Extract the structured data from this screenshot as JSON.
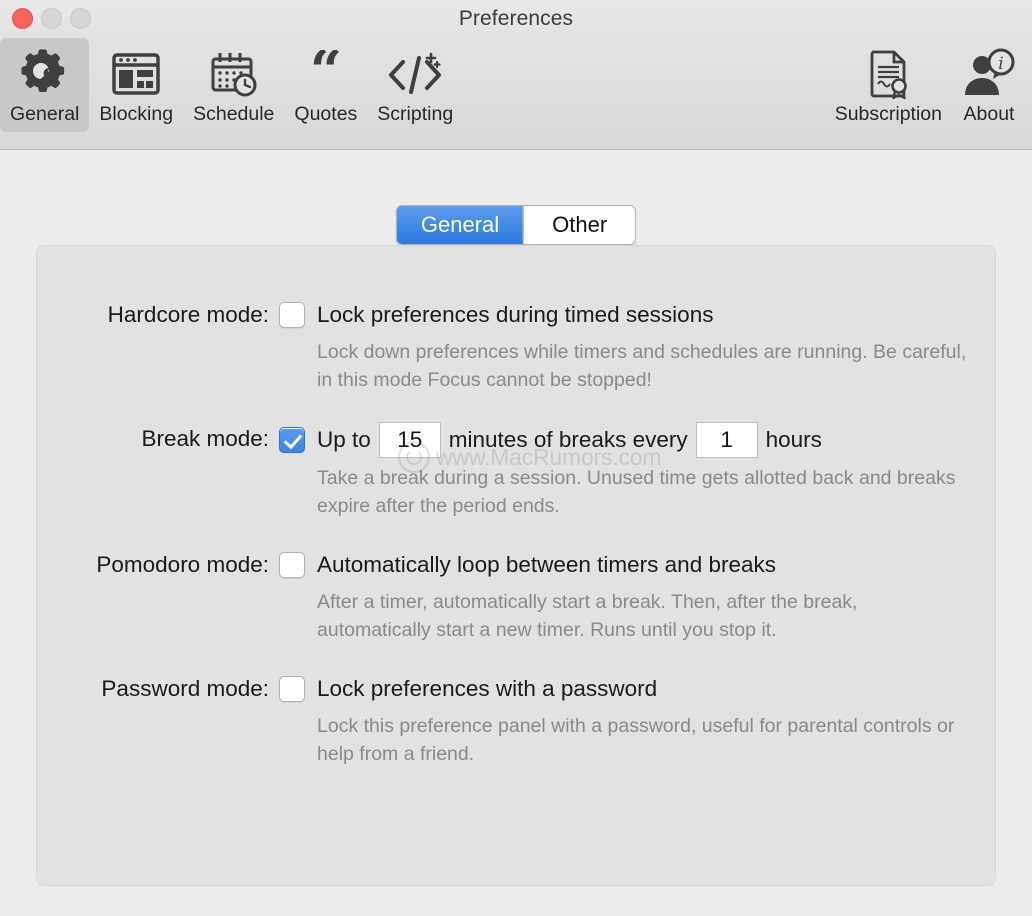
{
  "window": {
    "title": "Preferences",
    "traffic_lights": {
      "close_color": "#f4645c",
      "minimize_color": "#d6d6d6",
      "zoom_color": "#d6d6d6"
    }
  },
  "toolbar": {
    "left_items": [
      {
        "label": "General",
        "icon": "gear-wrench-icon",
        "selected": true
      },
      {
        "label": "Blocking",
        "icon": "browser-window-icon",
        "selected": false
      },
      {
        "label": "Schedule",
        "icon": "calendar-clock-icon",
        "selected": false
      },
      {
        "label": "Quotes",
        "icon": "quote-marks-icon",
        "selected": false
      },
      {
        "label": "Scripting",
        "icon": "code-tags-icon",
        "selected": false
      }
    ],
    "right_items": [
      {
        "label": "Subscription",
        "icon": "certificate-icon",
        "selected": false
      },
      {
        "label": "About",
        "icon": "person-info-icon",
        "selected": false
      }
    ]
  },
  "segmented_control": {
    "options": [
      {
        "label": "General",
        "active": true
      },
      {
        "label": "Other",
        "active": false
      }
    ],
    "active_color": "#2d7ae0"
  },
  "settings": [
    {
      "label": "Hardcore mode:",
      "checkbox_checked": false,
      "checkbox_label": "Lock preferences during timed sessions",
      "description": "Lock down preferences while timers and schedules are running. Be careful, in this mode Focus cannot be stopped!"
    },
    {
      "label": "Break mode:",
      "checkbox_checked": true,
      "inline": {
        "prefix": "Up to",
        "minutes_value": "15",
        "middle": "minutes of breaks every",
        "hours_value": "1",
        "suffix": "hours"
      },
      "description": "Take a break during a session. Unused time gets allotted back and breaks expire after the period ends."
    },
    {
      "label": "Pomodoro mode:",
      "checkbox_checked": false,
      "checkbox_label": "Automatically loop between timers and breaks",
      "description": "After a timer, automatically start a break. Then, after the break, automatically start a new timer. Runs until you stop it."
    },
    {
      "label": "Password mode:",
      "checkbox_checked": false,
      "checkbox_label": "Lock preferences with a password",
      "description": "Lock this preference panel with a password, useful for parental controls or help from a friend."
    }
  ],
  "watermark": {
    "text": "www.MacRumors.com"
  }
}
